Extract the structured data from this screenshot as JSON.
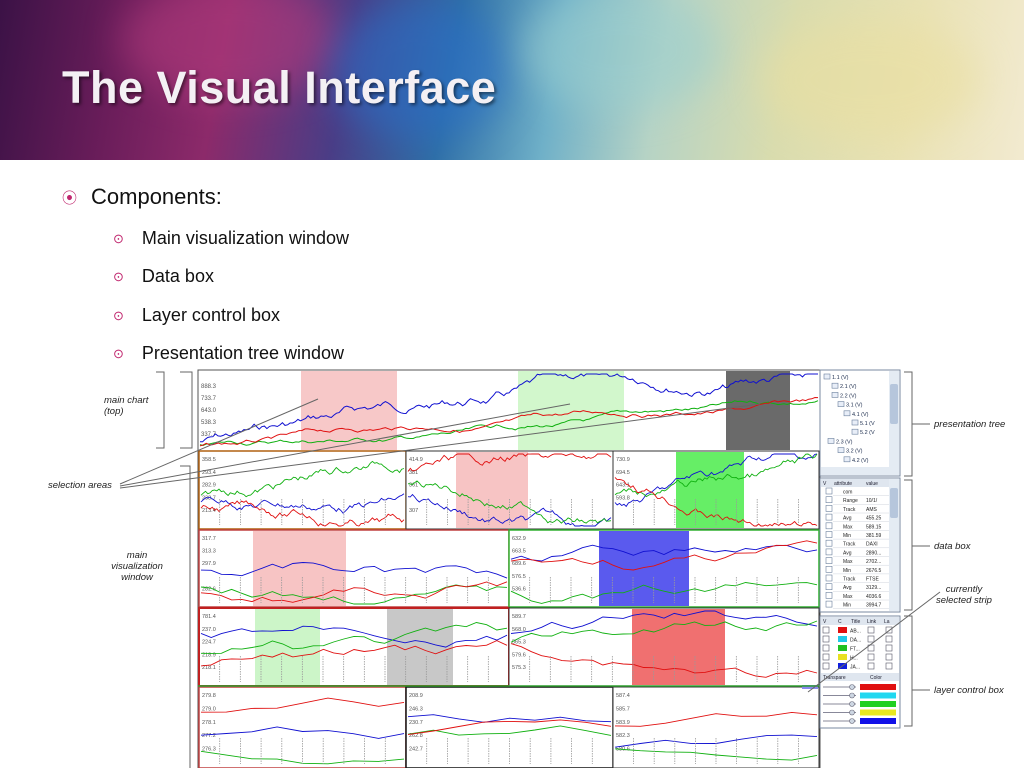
{
  "slide": {
    "title": "The Visual Interface",
    "bullets": {
      "main": "Components:",
      "sub": [
        "Main visualization window",
        "Data box",
        "Layer control box",
        "Presentation tree window"
      ]
    }
  },
  "callouts": {
    "main_chart": [
      "main chart",
      "(top)"
    ],
    "selection_areas": "selection areas",
    "main_window": [
      "main",
      "visualization",
      "window"
    ],
    "presentation_tree": "presentation tree",
    "data_box": "data box",
    "selected_strip": [
      "currently",
      "selected strip"
    ],
    "layer_control_box": "layer control box"
  },
  "main_chart_ticks": [
    "888.3",
    "733.7",
    "643.0",
    "538.3",
    "337.7"
  ],
  "strip_ticks": [
    [
      "358.5",
      "293.4",
      "282.9",
      "238.7",
      "213.4"
    ],
    [
      "414.9",
      "381",
      "361",
      "",
      "307"
    ],
    [
      "730.9",
      "694.5",
      "643.1",
      "593.8",
      ""
    ],
    [
      "317.7",
      "313.3",
      "297.9",
      "",
      "282.6"
    ],
    [
      "632.9",
      "663.5",
      "689.6",
      "576.5",
      "536.6"
    ],
    [
      "781.4",
      "237.0",
      "224.7",
      "218.9",
      "218.1"
    ],
    [
      "589.7",
      "568.0",
      "565.3",
      "579.6",
      "575.3"
    ],
    [
      "279.8",
      "279.0",
      "278.1",
      "277.2",
      "276.3"
    ],
    [
      "208.9",
      "246.3",
      "230.7",
      "262.8",
      "242.7"
    ],
    [
      "587.4",
      "585.7",
      "583.9",
      "582.3",
      "580.6"
    ]
  ],
  "presentation_tree": {
    "items": [
      "1.1 (V)",
      "2.1 (V)",
      "2.2 (V)",
      "3.1 (V)",
      "4.1 (V)",
      "5.1 (V",
      "5.2 (V",
      "2.3 (V)",
      "3.2 (V)",
      "4.2 (V)"
    ]
  },
  "data_box": {
    "headers": [
      "V",
      "attribute",
      "value"
    ],
    "rows": [
      [
        "com",
        ""
      ],
      [
        "Range",
        "10/1/"
      ],
      [
        "Track",
        "AMS"
      ],
      [
        "Avg",
        "455.25"
      ],
      [
        "Max",
        "589.15"
      ],
      [
        "Min",
        "381.59"
      ],
      [
        "Track",
        "DAXI"
      ],
      [
        "Avg",
        "2890..."
      ],
      [
        "Max",
        "2702..."
      ],
      [
        "Min",
        "2676.5"
      ],
      [
        "Track",
        "FTSE"
      ],
      [
        "Avg",
        "3129..."
      ],
      [
        "Max",
        "4036.6"
      ],
      [
        "Min",
        "3994.7"
      ]
    ]
  },
  "layer_control": {
    "headers": [
      "V",
      "C",
      "Title",
      "Link",
      "La"
    ],
    "rows": [
      "AB...",
      "DA...",
      "FT...",
      "H...",
      "JA..."
    ],
    "colors": [
      "#e01010",
      "#20c8e8",
      "#20c020",
      "#e8e020",
      "#1020e0"
    ],
    "slider_headers": [
      "Transpare",
      "Color"
    ],
    "slider_colors": [
      "#e01010",
      "#20d8f0",
      "#20d020",
      "#e8e820",
      "#1010e8"
    ]
  },
  "colors": {
    "accent": "#c0266e",
    "series": [
      "#1010d0",
      "#e01010",
      "#10b010",
      "#303030"
    ]
  }
}
